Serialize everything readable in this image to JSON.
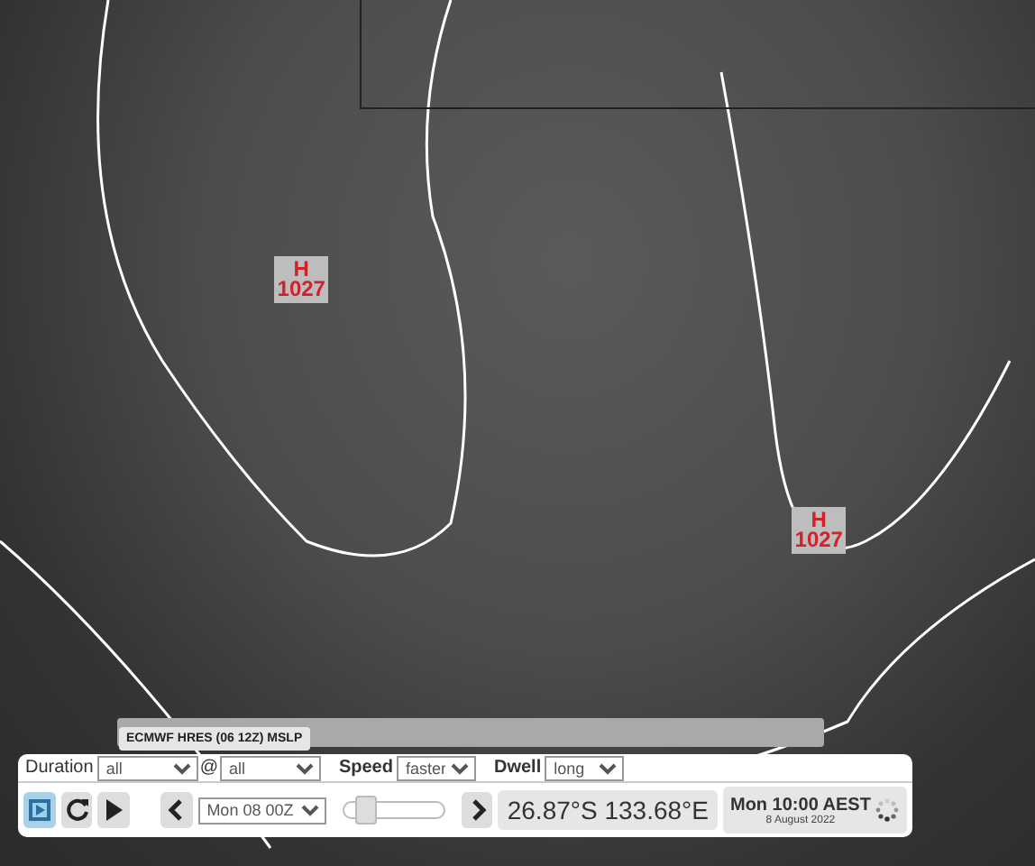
{
  "map": {
    "pressure_centres": [
      {
        "symbol": "H",
        "value": "1027"
      },
      {
        "symbol": "H",
        "value": "1027"
      }
    ]
  },
  "layer_bar": {
    "label": "ECMWF HRES (06 12Z) MSLP"
  },
  "controls": {
    "duration": {
      "label": "Duration",
      "value": "all"
    },
    "at": {
      "label": "@",
      "value": "all"
    },
    "speed": {
      "label": "Speed",
      "value": "faster"
    },
    "dwell": {
      "label": "Dwell",
      "value": "long"
    },
    "modes": [
      {
        "kind": "film",
        "selected": true
      },
      {
        "kind": "reload",
        "selected": false
      },
      {
        "kind": "play",
        "selected": false
      }
    ],
    "frame": {
      "value": "Mon 08 00Z"
    },
    "slider": {
      "level": 0.15
    },
    "coordinates": "26.87°S 133.68°E",
    "time": "Mon 10:00 AEST",
    "date": "8 August 2022"
  }
}
